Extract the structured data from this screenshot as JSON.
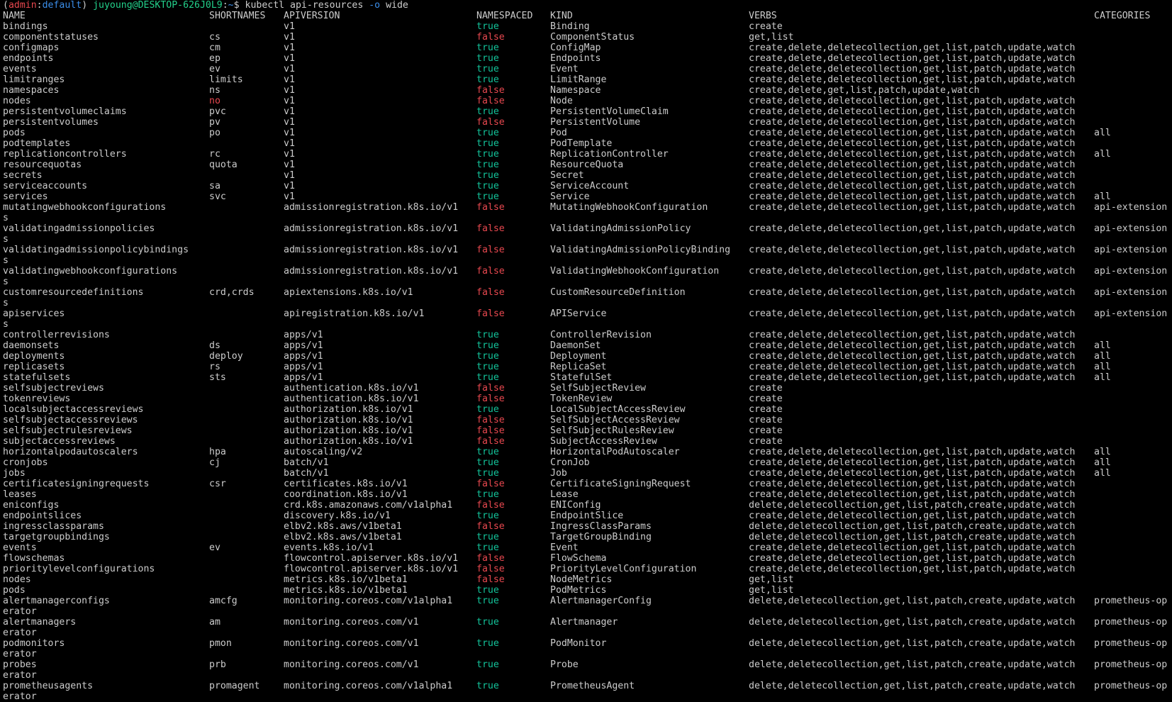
{
  "prompt": {
    "open": "(",
    "context": "admin",
    "sep": ":",
    "namespace": "default",
    "close": ")",
    "user_host": "juyoung@DESKTOP-626J0L9",
    "path_sep": ":",
    "path": "~",
    "dollar": "$",
    "command": "kubectl api-resources",
    "flag": "-o",
    "flag_value": "wide"
  },
  "columns": [
    "NAME",
    "SHORTNAMES",
    "APIVERSION",
    "NAMESPACED",
    "KIND",
    "VERBS",
    "CATEGORIES"
  ],
  "colors": {
    "true": "#13c39a",
    "false": "#e8484f",
    "background": "#000000",
    "text": "#cccccc"
  },
  "lines": [
    {
      "name": "bindings",
      "short": "",
      "api": "v1",
      "ns": "true",
      "kind": "Binding",
      "verbs": "create",
      "cat": ""
    },
    {
      "name": "componentstatuses",
      "short": "cs",
      "api": "v1",
      "ns": "false",
      "kind": "ComponentStatus",
      "verbs": "get,list",
      "cat": ""
    },
    {
      "name": "configmaps",
      "short": "cm",
      "api": "v1",
      "ns": "true",
      "kind": "ConfigMap",
      "verbs": "create,delete,deletecollection,get,list,patch,update,watch",
      "cat": ""
    },
    {
      "name": "endpoints",
      "short": "ep",
      "api": "v1",
      "ns": "true",
      "kind": "Endpoints",
      "verbs": "create,delete,deletecollection,get,list,patch,update,watch",
      "cat": ""
    },
    {
      "name": "events",
      "short": "ev",
      "api": "v1",
      "ns": "true",
      "kind": "Event",
      "verbs": "create,delete,deletecollection,get,list,patch,update,watch",
      "cat": ""
    },
    {
      "name": "limitranges",
      "short": "limits",
      "api": "v1",
      "ns": "true",
      "kind": "LimitRange",
      "verbs": "create,delete,deletecollection,get,list,patch,update,watch",
      "cat": ""
    },
    {
      "name": "namespaces",
      "short": "ns",
      "api": "v1",
      "ns": "false",
      "kind": "Namespace",
      "verbs": "create,delete,get,list,patch,update,watch",
      "cat": ""
    },
    {
      "name": "nodes",
      "short": "no",
      "short_red": true,
      "api": "v1",
      "ns": "false",
      "kind": "Node",
      "verbs": "create,delete,deletecollection,get,list,patch,update,watch",
      "cat": ""
    },
    {
      "name": "persistentvolumeclaims",
      "short": "pvc",
      "api": "v1",
      "ns": "true",
      "kind": "PersistentVolumeClaim",
      "verbs": "create,delete,deletecollection,get,list,patch,update,watch",
      "cat": ""
    },
    {
      "name": "persistentvolumes",
      "short": "pv",
      "api": "v1",
      "ns": "false",
      "kind": "PersistentVolume",
      "verbs": "create,delete,deletecollection,get,list,patch,update,watch",
      "cat": ""
    },
    {
      "name": "pods",
      "short": "po",
      "api": "v1",
      "ns": "true",
      "kind": "Pod",
      "verbs": "create,delete,deletecollection,get,list,patch,update,watch",
      "cat": "all"
    },
    {
      "name": "podtemplates",
      "short": "",
      "api": "v1",
      "ns": "true",
      "kind": "PodTemplate",
      "verbs": "create,delete,deletecollection,get,list,patch,update,watch",
      "cat": ""
    },
    {
      "name": "replicationcontrollers",
      "short": "rc",
      "api": "v1",
      "ns": "true",
      "kind": "ReplicationController",
      "verbs": "create,delete,deletecollection,get,list,patch,update,watch",
      "cat": "all"
    },
    {
      "name": "resourcequotas",
      "short": "quota",
      "api": "v1",
      "ns": "true",
      "kind": "ResourceQuota",
      "verbs": "create,delete,deletecollection,get,list,patch,update,watch",
      "cat": ""
    },
    {
      "name": "secrets",
      "short": "",
      "api": "v1",
      "ns": "true",
      "kind": "Secret",
      "verbs": "create,delete,deletecollection,get,list,patch,update,watch",
      "cat": ""
    },
    {
      "name": "serviceaccounts",
      "short": "sa",
      "api": "v1",
      "ns": "true",
      "kind": "ServiceAccount",
      "verbs": "create,delete,deletecollection,get,list,patch,update,watch",
      "cat": ""
    },
    {
      "name": "services",
      "short": "svc",
      "api": "v1",
      "ns": "true",
      "kind": "Service",
      "verbs": "create,delete,deletecollection,get,list,patch,update,watch",
      "cat": "all"
    },
    {
      "name": "mutatingwebhookconfigurations",
      "short": "",
      "api": "admissionregistration.k8s.io/v1",
      "ns": "false",
      "kind": "MutatingWebhookConfiguration",
      "verbs": "create,delete,deletecollection,get,list,patch,update,watch",
      "cat": "api-extension"
    },
    {
      "wrap": "s"
    },
    {
      "name": "validatingadmissionpolicies",
      "short": "",
      "api": "admissionregistration.k8s.io/v1",
      "ns": "false",
      "kind": "ValidatingAdmissionPolicy",
      "verbs": "create,delete,deletecollection,get,list,patch,update,watch",
      "cat": "api-extension"
    },
    {
      "wrap": "s"
    },
    {
      "name": "validatingadmissionpolicybindings",
      "short": "",
      "api": "admissionregistration.k8s.io/v1",
      "ns": "false",
      "kind": "ValidatingAdmissionPolicyBinding",
      "verbs": "create,delete,deletecollection,get,list,patch,update,watch",
      "cat": "api-extension"
    },
    {
      "wrap": "s"
    },
    {
      "name": "validatingwebhookconfigurations",
      "short": "",
      "api": "admissionregistration.k8s.io/v1",
      "ns": "false",
      "kind": "ValidatingWebhookConfiguration",
      "verbs": "create,delete,deletecollection,get,list,patch,update,watch",
      "cat": "api-extension"
    },
    {
      "wrap": "s"
    },
    {
      "name": "customresourcedefinitions",
      "short": "crd,crds",
      "api": "apiextensions.k8s.io/v1",
      "ns": "false",
      "kind": "CustomResourceDefinition",
      "verbs": "create,delete,deletecollection,get,list,patch,update,watch",
      "cat": "api-extension"
    },
    {
      "wrap": "s"
    },
    {
      "name": "apiservices",
      "short": "",
      "api": "apiregistration.k8s.io/v1",
      "ns": "false",
      "kind": "APIService",
      "verbs": "create,delete,deletecollection,get,list,patch,update,watch",
      "cat": "api-extension"
    },
    {
      "wrap": "s"
    },
    {
      "name": "controllerrevisions",
      "short": "",
      "api": "apps/v1",
      "ns": "true",
      "kind": "ControllerRevision",
      "verbs": "create,delete,deletecollection,get,list,patch,update,watch",
      "cat": ""
    },
    {
      "name": "daemonsets",
      "short": "ds",
      "api": "apps/v1",
      "ns": "true",
      "kind": "DaemonSet",
      "verbs": "create,delete,deletecollection,get,list,patch,update,watch",
      "cat": "all"
    },
    {
      "name": "deployments",
      "short": "deploy",
      "api": "apps/v1",
      "ns": "true",
      "kind": "Deployment",
      "verbs": "create,delete,deletecollection,get,list,patch,update,watch",
      "cat": "all"
    },
    {
      "name": "replicasets",
      "short": "rs",
      "api": "apps/v1",
      "ns": "true",
      "kind": "ReplicaSet",
      "verbs": "create,delete,deletecollection,get,list,patch,update,watch",
      "cat": "all"
    },
    {
      "name": "statefulsets",
      "short": "sts",
      "api": "apps/v1",
      "ns": "true",
      "kind": "StatefulSet",
      "verbs": "create,delete,deletecollection,get,list,patch,update,watch",
      "cat": "all"
    },
    {
      "name": "selfsubjectreviews",
      "short": "",
      "api": "authentication.k8s.io/v1",
      "ns": "false",
      "kind": "SelfSubjectReview",
      "verbs": "create",
      "cat": ""
    },
    {
      "name": "tokenreviews",
      "short": "",
      "api": "authentication.k8s.io/v1",
      "ns": "false",
      "kind": "TokenReview",
      "verbs": "create",
      "cat": ""
    },
    {
      "name": "localsubjectaccessreviews",
      "short": "",
      "api": "authorization.k8s.io/v1",
      "ns": "true",
      "kind": "LocalSubjectAccessReview",
      "verbs": "create",
      "cat": ""
    },
    {
      "name": "selfsubjectaccessreviews",
      "short": "",
      "api": "authorization.k8s.io/v1",
      "ns": "false",
      "kind": "SelfSubjectAccessReview",
      "verbs": "create",
      "cat": ""
    },
    {
      "name": "selfsubjectrulesreviews",
      "short": "",
      "api": "authorization.k8s.io/v1",
      "ns": "false",
      "kind": "SelfSubjectRulesReview",
      "verbs": "create",
      "cat": ""
    },
    {
      "name": "subjectaccessreviews",
      "short": "",
      "api": "authorization.k8s.io/v1",
      "ns": "false",
      "kind": "SubjectAccessReview",
      "verbs": "create",
      "cat": ""
    },
    {
      "name": "horizontalpodautoscalers",
      "short": "hpa",
      "api": "autoscaling/v2",
      "ns": "true",
      "kind": "HorizontalPodAutoscaler",
      "verbs": "create,delete,deletecollection,get,list,patch,update,watch",
      "cat": "all"
    },
    {
      "name": "cronjobs",
      "short": "cj",
      "api": "batch/v1",
      "ns": "true",
      "kind": "CronJob",
      "verbs": "create,delete,deletecollection,get,list,patch,update,watch",
      "cat": "all"
    },
    {
      "name": "jobs",
      "short": "",
      "api": "batch/v1",
      "ns": "true",
      "kind": "Job",
      "verbs": "create,delete,deletecollection,get,list,patch,update,watch",
      "cat": "all"
    },
    {
      "name": "certificatesigningrequests",
      "short": "csr",
      "api": "certificates.k8s.io/v1",
      "ns": "false",
      "kind": "CertificateSigningRequest",
      "verbs": "create,delete,deletecollection,get,list,patch,update,watch",
      "cat": ""
    },
    {
      "name": "leases",
      "short": "",
      "api": "coordination.k8s.io/v1",
      "ns": "true",
      "kind": "Lease",
      "verbs": "create,delete,deletecollection,get,list,patch,update,watch",
      "cat": ""
    },
    {
      "name": "eniconfigs",
      "short": "",
      "api": "crd.k8s.amazonaws.com/v1alpha1",
      "ns": "false",
      "kind": "ENIConfig",
      "verbs": "delete,deletecollection,get,list,patch,create,update,watch",
      "cat": ""
    },
    {
      "name": "endpointslices",
      "short": "",
      "api": "discovery.k8s.io/v1",
      "ns": "true",
      "kind": "EndpointSlice",
      "verbs": "create,delete,deletecollection,get,list,patch,update,watch",
      "cat": ""
    },
    {
      "name": "ingressclassparams",
      "short": "",
      "api": "elbv2.k8s.aws/v1beta1",
      "ns": "false",
      "kind": "IngressClassParams",
      "verbs": "delete,deletecollection,get,list,patch,create,update,watch",
      "cat": ""
    },
    {
      "name": "targetgroupbindings",
      "short": "",
      "api": "elbv2.k8s.aws/v1beta1",
      "ns": "true",
      "kind": "TargetGroupBinding",
      "verbs": "delete,deletecollection,get,list,patch,create,update,watch",
      "cat": ""
    },
    {
      "name": "events",
      "short": "ev",
      "api": "events.k8s.io/v1",
      "ns": "true",
      "kind": "Event",
      "verbs": "create,delete,deletecollection,get,list,patch,update,watch",
      "cat": ""
    },
    {
      "name": "flowschemas",
      "short": "",
      "api": "flowcontrol.apiserver.k8s.io/v1",
      "ns": "false",
      "kind": "FlowSchema",
      "verbs": "create,delete,deletecollection,get,list,patch,update,watch",
      "cat": ""
    },
    {
      "name": "prioritylevelconfigurations",
      "short": "",
      "api": "flowcontrol.apiserver.k8s.io/v1",
      "ns": "false",
      "kind": "PriorityLevelConfiguration",
      "verbs": "create,delete,deletecollection,get,list,patch,update,watch",
      "cat": ""
    },
    {
      "name": "nodes",
      "short": "",
      "api": "metrics.k8s.io/v1beta1",
      "ns": "false",
      "kind": "NodeMetrics",
      "verbs": "get,list",
      "cat": ""
    },
    {
      "name": "pods",
      "short": "",
      "api": "metrics.k8s.io/v1beta1",
      "ns": "true",
      "kind": "PodMetrics",
      "verbs": "get,list",
      "cat": ""
    },
    {
      "name": "alertmanagerconfigs",
      "short": "amcfg",
      "api": "monitoring.coreos.com/v1alpha1",
      "ns": "true",
      "kind": "AlertmanagerConfig",
      "verbs": "delete,deletecollection,get,list,patch,create,update,watch",
      "cat": "prometheus-op"
    },
    {
      "wrap": "erator"
    },
    {
      "name": "alertmanagers",
      "short": "am",
      "api": "monitoring.coreos.com/v1",
      "ns": "true",
      "kind": "Alertmanager",
      "verbs": "delete,deletecollection,get,list,patch,create,update,watch",
      "cat": "prometheus-op"
    },
    {
      "wrap": "erator"
    },
    {
      "name": "podmonitors",
      "short": "pmon",
      "api": "monitoring.coreos.com/v1",
      "ns": "true",
      "kind": "PodMonitor",
      "verbs": "delete,deletecollection,get,list,patch,create,update,watch",
      "cat": "prometheus-op"
    },
    {
      "wrap": "erator"
    },
    {
      "name": "probes",
      "short": "prb",
      "api": "monitoring.coreos.com/v1",
      "ns": "true",
      "kind": "Probe",
      "verbs": "delete,deletecollection,get,list,patch,create,update,watch",
      "cat": "prometheus-op"
    },
    {
      "wrap": "erator"
    },
    {
      "name": "prometheusagents",
      "short": "promagent",
      "api": "monitoring.coreos.com/v1alpha1",
      "ns": "true",
      "kind": "PrometheusAgent",
      "verbs": "delete,deletecollection,get,list,patch,create,update,watch",
      "cat": "prometheus-op"
    },
    {
      "wrap": "erator"
    }
  ]
}
